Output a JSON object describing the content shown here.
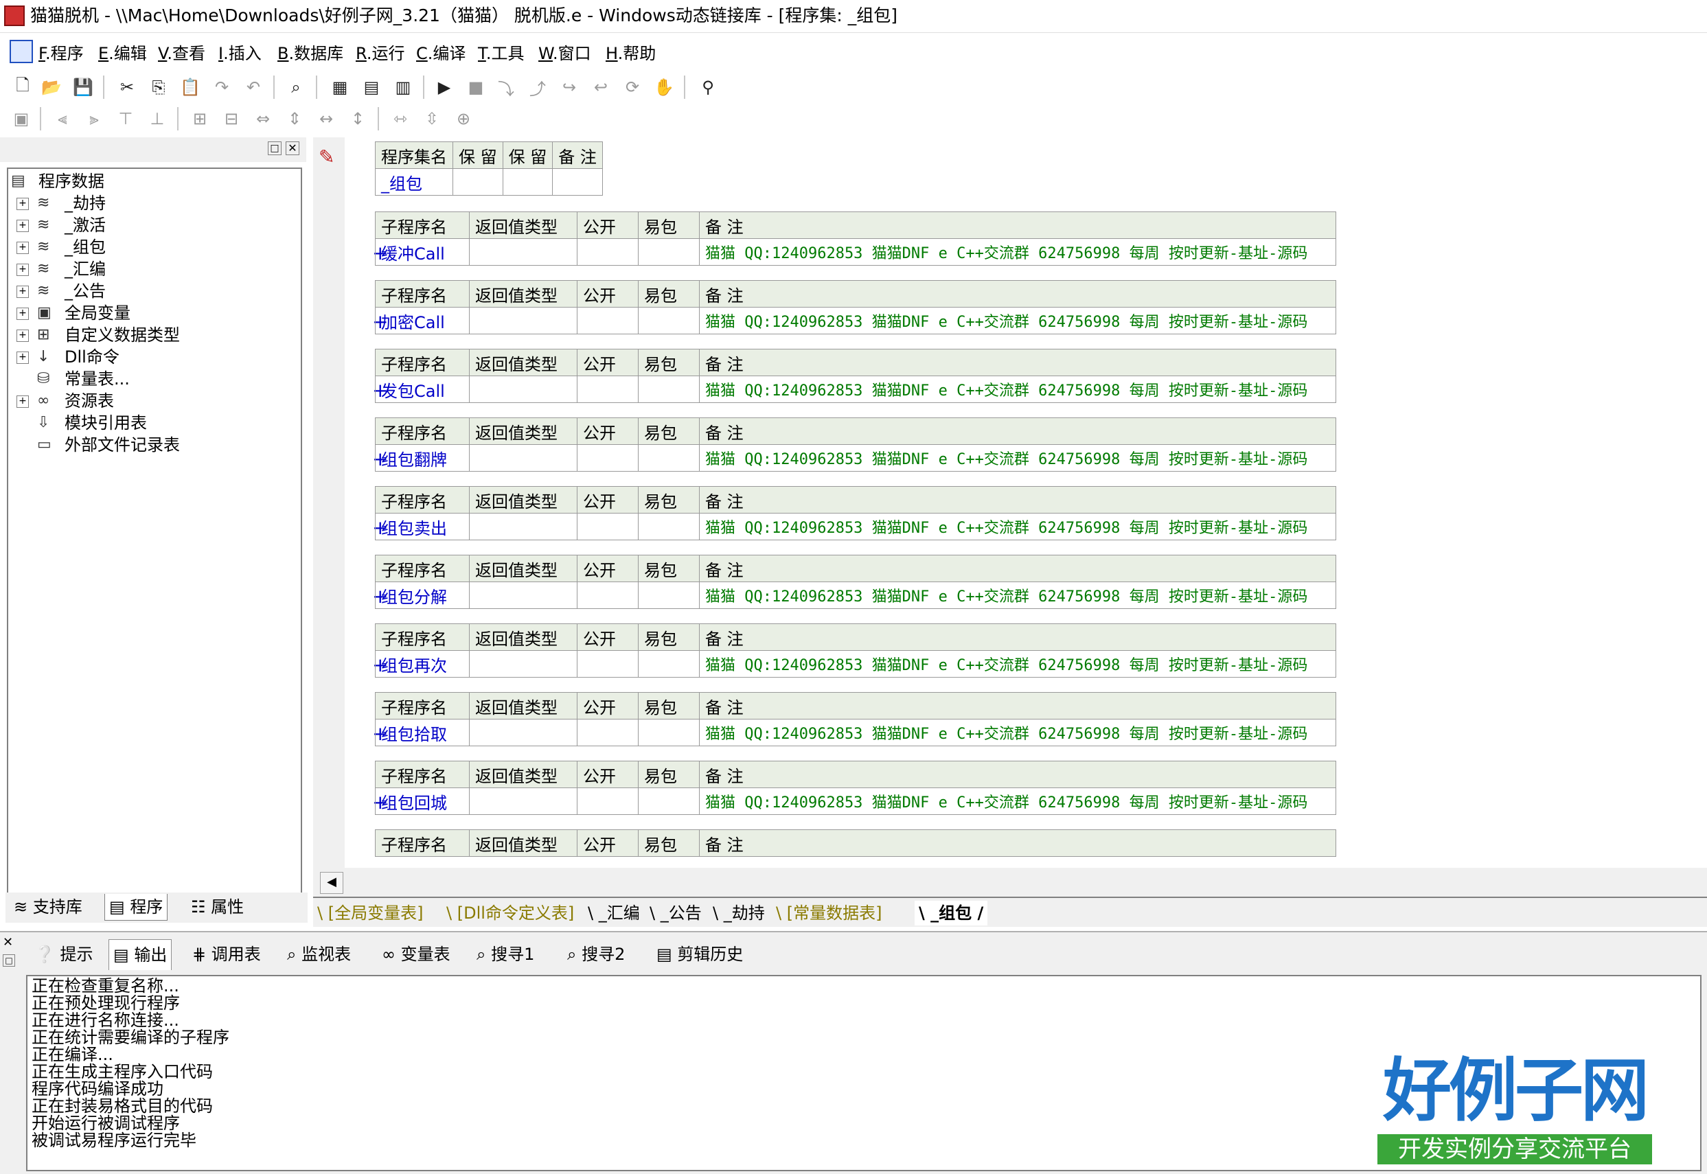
{
  "window": {
    "title": "猫猫脱机 - \\\\Mac\\Home\\Downloads\\好例子网_3.21（猫猫） 脱机版.e - Windows动态链接库 - [程序集: _组包]"
  },
  "menu": [
    {
      "key": "F",
      "label": "程序"
    },
    {
      "key": "E",
      "label": "编辑"
    },
    {
      "key": "V",
      "label": "查看"
    },
    {
      "key": "I",
      "label": "插入"
    },
    {
      "key": "B",
      "label": "数据库"
    },
    {
      "key": "R",
      "label": "运行"
    },
    {
      "key": "C",
      "label": "编译"
    },
    {
      "key": "T",
      "label": "工具"
    },
    {
      "key": "W",
      "label": "窗口"
    },
    {
      "key": "H",
      "label": "帮助"
    }
  ],
  "tree": {
    "root": "程序数据",
    "items": [
      {
        "label": "_劫持",
        "icon": "module-icon",
        "expand": true
      },
      {
        "label": "_激活",
        "icon": "module-icon",
        "expand": true
      },
      {
        "label": "_组包",
        "icon": "module-icon",
        "expand": true
      },
      {
        "label": "_汇编",
        "icon": "module-icon",
        "expand": true
      },
      {
        "label": "_公告",
        "icon": "module-icon",
        "expand": true
      },
      {
        "label": "全局变量",
        "icon": "global-var-icon",
        "expand": true
      },
      {
        "label": "自定义数据类型",
        "icon": "datatype-icon",
        "expand": true
      },
      {
        "label": "Dll命令",
        "icon": "dll-icon",
        "expand": true
      },
      {
        "label": "常量表...",
        "icon": "constant-icon",
        "expand": false
      },
      {
        "label": "资源表",
        "icon": "resource-icon",
        "expand": true
      },
      {
        "label": "模块引用表",
        "icon": "module-ref-icon",
        "expand": false
      },
      {
        "label": "外部文件记录表",
        "icon": "file-record-icon",
        "expand": false
      }
    ]
  },
  "left_tabs": [
    "支持库",
    "程序",
    "属性"
  ],
  "assembly": {
    "headers": [
      "程序集名",
      "保 留",
      "保 留",
      "备 注"
    ],
    "name": "_组包"
  },
  "sub_headers": [
    "子程序名",
    "返回值类型",
    "公开",
    "易包",
    "备 注"
  ],
  "subs": [
    {
      "name": "缓冲Call",
      "note": "猫猫 QQ:1240962853 猫猫DNF e C++交流群  624756998  每周 按时更新-基址-源码"
    },
    {
      "name": "加密Call",
      "note": "猫猫 QQ:1240962853 猫猫DNF e C++交流群  624756998  每周 按时更新-基址-源码"
    },
    {
      "name": "发包Call",
      "note": "猫猫 QQ:1240962853 猫猫DNF e C++交流群  624756998  每周 按时更新-基址-源码"
    },
    {
      "name": "组包翻牌",
      "note": "猫猫 QQ:1240962853 猫猫DNF e C++交流群  624756998  每周 按时更新-基址-源码"
    },
    {
      "name": "组包卖出",
      "note": "猫猫 QQ:1240962853 猫猫DNF e C++交流群  624756998  每周 按时更新-基址-源码"
    },
    {
      "name": "组包分解",
      "note": "猫猫 QQ:1240962853 猫猫DNF e C++交流群  624756998  每周 按时更新-基址-源码"
    },
    {
      "name": "组包再次",
      "note": "猫猫 QQ:1240962853 猫猫DNF e C++交流群  624756998  每周 按时更新-基址-源码"
    },
    {
      "name": "组包拾取",
      "note": "猫猫 QQ:1240962853 猫猫DNF e C++交流群  624756998  每周 按时更新-基址-源码"
    },
    {
      "name": "组包回城",
      "note": "猫猫 QQ:1240962853 猫猫DNF e C++交流群  624756998  每周 按时更新-基址-源码"
    }
  ],
  "expand_symbol": "+",
  "editor_tabs": [
    {
      "label": "[全局变量表]",
      "style": "olive"
    },
    {
      "label": "[Dll命令定义表]",
      "style": "olive"
    },
    {
      "label": "_汇编",
      "style": "normal"
    },
    {
      "label": "_公告",
      "style": "normal"
    },
    {
      "label": "_劫持",
      "style": "normal"
    },
    {
      "label": "[常量数据表]",
      "style": "olive"
    },
    {
      "label": "_组包",
      "style": "active"
    }
  ],
  "bottom_tabs": [
    "提示",
    "输出",
    "调用表",
    "监视表",
    "变量表",
    "搜寻1",
    "搜寻2",
    "剪辑历史"
  ],
  "output_lines": [
    "正在检查重复名称...",
    "正在预处理现行程序",
    "正在进行名称连接...",
    "正在统计需要编译的子程序",
    "正在编译...",
    "正在生成主程序入口代码",
    "程序代码编译成功",
    "正在封装易格式目的代码",
    "开始运行被调试程序",
    "被调试易程序运行完毕"
  ],
  "watermark": {
    "brand": "好例子网",
    "slogan": "开发实例分享交流平台"
  }
}
